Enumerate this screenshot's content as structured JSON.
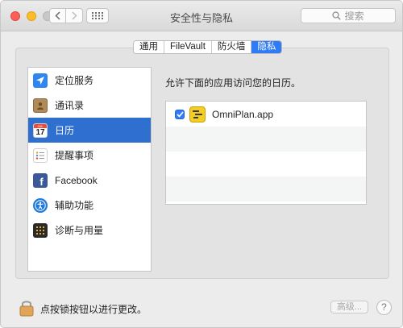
{
  "window": {
    "title": "安全性与隐私"
  },
  "search": {
    "placeholder": "搜索"
  },
  "tabs": [
    {
      "label": "通用",
      "active": false
    },
    {
      "label": "FileVault",
      "active": false
    },
    {
      "label": "防火墙",
      "active": false
    },
    {
      "label": "隐私",
      "active": true
    }
  ],
  "categories": [
    {
      "label": "定位服务",
      "icon": "location-arrow-icon"
    },
    {
      "label": "通讯录",
      "icon": "contacts-book-icon"
    },
    {
      "label": "日历",
      "icon": "calendar-icon",
      "selected": true,
      "calendar_day": "17",
      "calendar_month": "JUL"
    },
    {
      "label": "提醒事项",
      "icon": "reminders-icon"
    },
    {
      "label": "Facebook",
      "icon": "facebook-icon"
    },
    {
      "label": "辅助功能",
      "icon": "accessibility-icon"
    },
    {
      "label": "诊断与用量",
      "icon": "diagnostics-icon"
    }
  ],
  "main": {
    "description": "允许下面的应用访问您的日历。",
    "apps": [
      {
        "name": "OmniPlan.app",
        "checked": true,
        "icon": "omniplan-app-icon"
      }
    ]
  },
  "footer": {
    "lock_text": "点按锁按钮以进行更改。",
    "advanced_label": "高级...",
    "help_label": "?"
  },
  "colors": {
    "accent": "#2f7cf6",
    "selection": "#2f6fd0"
  }
}
